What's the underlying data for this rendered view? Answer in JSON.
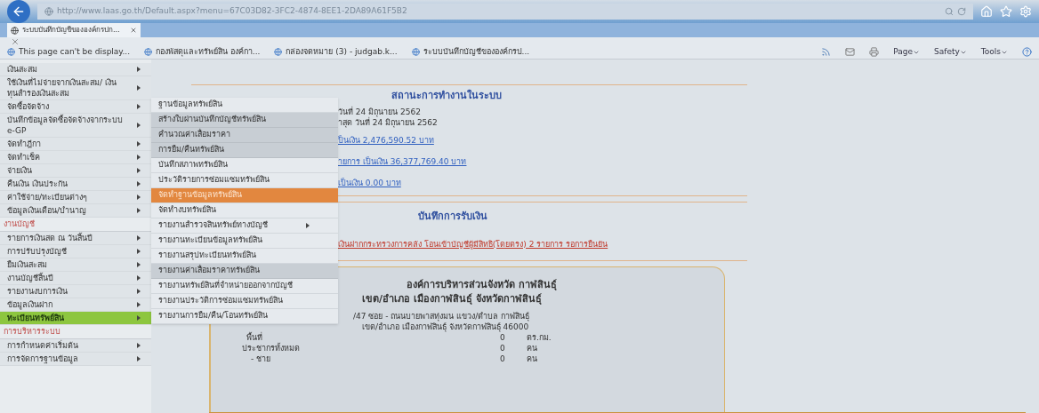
{
  "browser": {
    "address": "http://www.laas.go.th/Default.aspx?menu=67C03D82-3FC2-4874-8EE1-2DA89A61F5B2",
    "tab": "ระบบบันทึกบัญชีขององค์กรปก...",
    "favorites": [
      "This page can't be display...",
      "กองพัสดุและทรัพย์สิน องค์กา...",
      "กล่องจดหมาย (3) - judgab.k...",
      "ระบบบันทึกบัญชีขององค์กรป..."
    ],
    "commands": [
      "Page",
      "Safety",
      "Tools"
    ]
  },
  "sidebar": {
    "items": [
      {
        "kind": "item",
        "label": "เงินสะสม",
        "selected": false
      },
      {
        "kind": "item",
        "label": "ใช้เงินที่ไม่จ่ายจากเงินสะสม/ เงินทุนสำรองเงินสะสม",
        "selected": false
      },
      {
        "kind": "item",
        "label": "จัดซื้อจัดจ้าง",
        "selected": false
      },
      {
        "kind": "item",
        "label": "บันทึกข้อมูลจัดซื้อจัดจ้างจากระบบ e-GP",
        "selected": false
      },
      {
        "kind": "item",
        "label": "จัดทำฎีกา",
        "selected": false
      },
      {
        "kind": "item",
        "label": "จัดทำเช็ค",
        "selected": false
      },
      {
        "kind": "item",
        "label": "จ่ายเงิน",
        "selected": false
      },
      {
        "kind": "item",
        "label": "คืนเงิน เงินประกัน",
        "selected": false
      },
      {
        "kind": "item",
        "label": "ค่าใช้จ่าย/ทะเบียนต่างๆ",
        "selected": false
      },
      {
        "kind": "item",
        "label": "ข้อมูลเงินเดือน/บำนาญ",
        "selected": false
      },
      {
        "kind": "header",
        "label": "งานบัญชี"
      },
      {
        "kind": "item",
        "label": "รายการเงินสด ณ วันสิ้นปี",
        "selected": false
      },
      {
        "kind": "item",
        "label": "การปรับปรุงบัญชี",
        "selected": false
      },
      {
        "kind": "item",
        "label": "ยืมเงินสะสม",
        "selected": false
      },
      {
        "kind": "item",
        "label": "งานบัญชีสิ้นปี",
        "selected": false
      },
      {
        "kind": "item",
        "label": "รายงานงบการเงิน",
        "selected": false
      },
      {
        "kind": "item",
        "label": "ข้อมูลเงินฝาก",
        "selected": false
      },
      {
        "kind": "item",
        "label": "ทะเบียนทรัพย์สิน",
        "selected": true
      },
      {
        "kind": "header",
        "label": "การบริหารระบบ"
      },
      {
        "kind": "item",
        "label": "การกำหนดค่าเริ่มต้น",
        "selected": false
      },
      {
        "kind": "item",
        "label": "การจัดการฐานข้อมูล",
        "selected": false
      }
    ]
  },
  "submenu": {
    "items": [
      {
        "label": "ฐานข้อมูลทรัพย์สิน",
        "selected": false,
        "shaded": false,
        "has_children": false
      },
      {
        "label": "สร้างใบผ่านบันทึกบัญชีทรัพย์สิน",
        "selected": false,
        "shaded": true,
        "has_children": false
      },
      {
        "label": "คำนวณค่าเสื่อมราคา",
        "selected": false,
        "shaded": true,
        "has_children": false
      },
      {
        "label": "การยืม/คืนทรัพย์สิน",
        "selected": false,
        "shaded": true,
        "has_children": false
      },
      {
        "label": "บันทึกสภาพทรัพย์สิน",
        "selected": false,
        "shaded": false,
        "has_children": false
      },
      {
        "label": "ประวัติรายการซ่อมแซมทรัพย์สิน",
        "selected": false,
        "shaded": false,
        "has_children": false
      },
      {
        "label": "จัดทำฐานข้อมูลทรัพย์สิน",
        "selected": true,
        "shaded": false,
        "has_children": false
      },
      {
        "label": "จัดทำงบทรัพย์สิน",
        "selected": false,
        "shaded": false,
        "has_children": false
      },
      {
        "label": "รายงานสำรวจสินทรัพย์ทางบัญชี",
        "selected": false,
        "shaded": false,
        "has_children": true
      },
      {
        "label": "รายงานทะเบียนข้อมูลทรัพย์สิน",
        "selected": false,
        "shaded": false,
        "has_children": false
      },
      {
        "label": "รายงานสรุปทะเบียนทรัพย์สิน",
        "selected": false,
        "shaded": false,
        "has_children": false
      },
      {
        "label": "รายงานค่าเสื่อมราคาทรัพย์สิน",
        "selected": false,
        "shaded": true,
        "has_children": false
      },
      {
        "label": "รายงานทรัพย์สินที่จำหน่ายออกจากบัญชี",
        "selected": false,
        "shaded": false,
        "has_children": false
      },
      {
        "label": "รายงานประวัติการซ่อมแซมทรัพย์สิน",
        "selected": false,
        "shaded": false,
        "has_children": false
      },
      {
        "label": "รายงานการยืม/คืน/โอนทรัพย์สิน",
        "selected": false,
        "shaded": false,
        "has_children": false
      }
    ]
  },
  "status_panel": {
    "title": "สถานะการทำงานในระบบ",
    "lines": [
      "วันที่ 24 มิถุนายน 2562",
      "าสุด วันที่ 24 มิถุนายน 2562"
    ],
    "links": [
      "ป็นเงิน 2,476,590.52 บาท",
      "ายการ เป็นเงิน 36,377,769.40 บาท",
      "เป็นเงิน 0.00 บาท"
    ]
  },
  "receipt_panel": {
    "title": "บันทึกการรับเงิน",
    "link": "เงินฝากกระทรวงการคลัง โอนเข้าบัญชีผู้มีสิทธิ(โดยตรง) 2 รายการ รอการยืนยัน"
  },
  "org_panel": {
    "name": "องค์การบริหารส่วนจังหวัด กาฬสินธุ์",
    "district": "เขต/อำเภอ เมืองกาฬสินธุ์ จังหวัดกาฬสินธุ์",
    "address": [
      "/47 ซอย - ถนนบายพาสทุ่งมน แขวง/ตำบล กาฬสินธุ์",
      "เขต/อำเภอ เมืองกาฬสินธุ์ จังหวัดกาฬสินธุ์ 46000"
    ],
    "stats": [
      {
        "label": "พื้นที่",
        "value": "0",
        "unit": "ตร.กม."
      },
      {
        "label": "ประชากรทั้งหมด",
        "value": "0",
        "unit": "คน"
      },
      {
        "label": "- ชาย",
        "value": "0",
        "unit": "คน"
      }
    ]
  }
}
